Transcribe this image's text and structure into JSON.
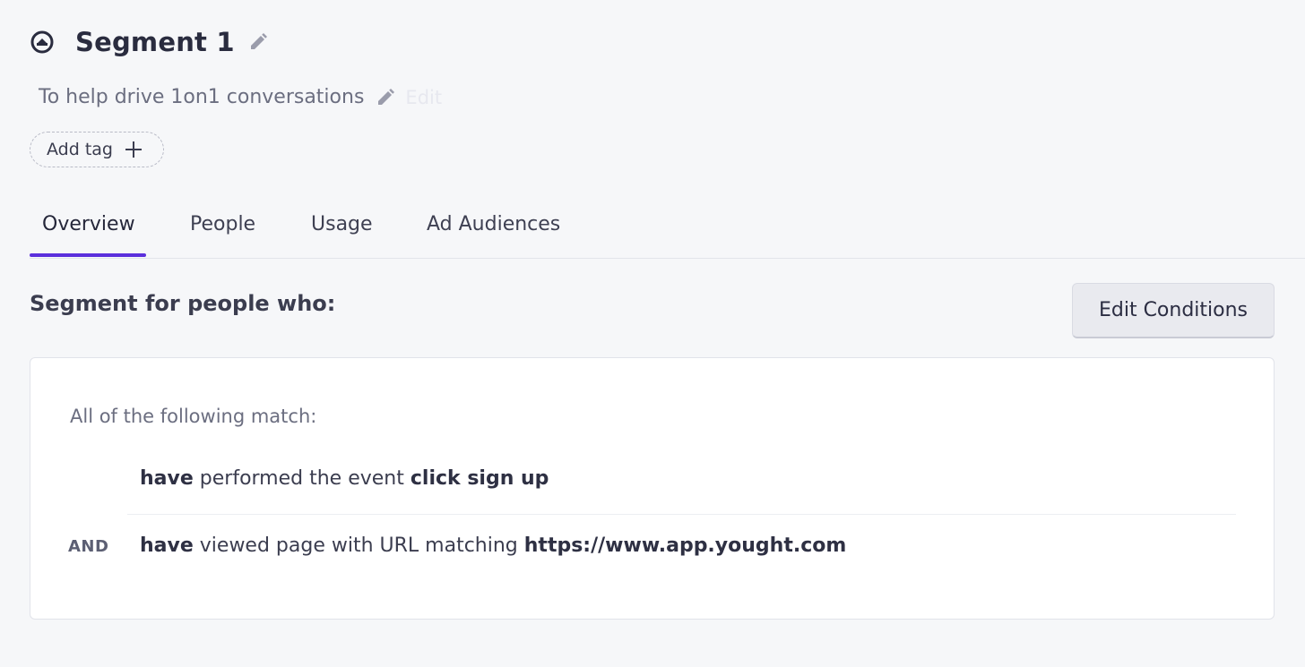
{
  "header": {
    "title": "Segment 1",
    "icon": "segment-icon",
    "edit_icon": "pencil-icon"
  },
  "description": {
    "text": "To help drive 1on1 conversations",
    "edit_label": "Edit"
  },
  "tags": {
    "add_label": "Add tag"
  },
  "tabs": [
    {
      "label": "Overview",
      "active": true
    },
    {
      "label": "People",
      "active": false
    },
    {
      "label": "Usage",
      "active": false
    },
    {
      "label": "Ad Audiences",
      "active": false
    }
  ],
  "overview": {
    "section_title": "Segment for people who:",
    "edit_button": "Edit Conditions",
    "match_label": "All of the following match:",
    "and_label": "AND",
    "conditions": [
      {
        "verb": "have",
        "phrase": " performed the event ",
        "value": "click sign up"
      },
      {
        "verb": "have",
        "phrase": " viewed page with URL matching ",
        "value": "https://www.app.yought.com"
      }
    ]
  },
  "colors": {
    "accent": "#5b2fdc",
    "background": "#f6f7f9",
    "card": "#ffffff"
  }
}
